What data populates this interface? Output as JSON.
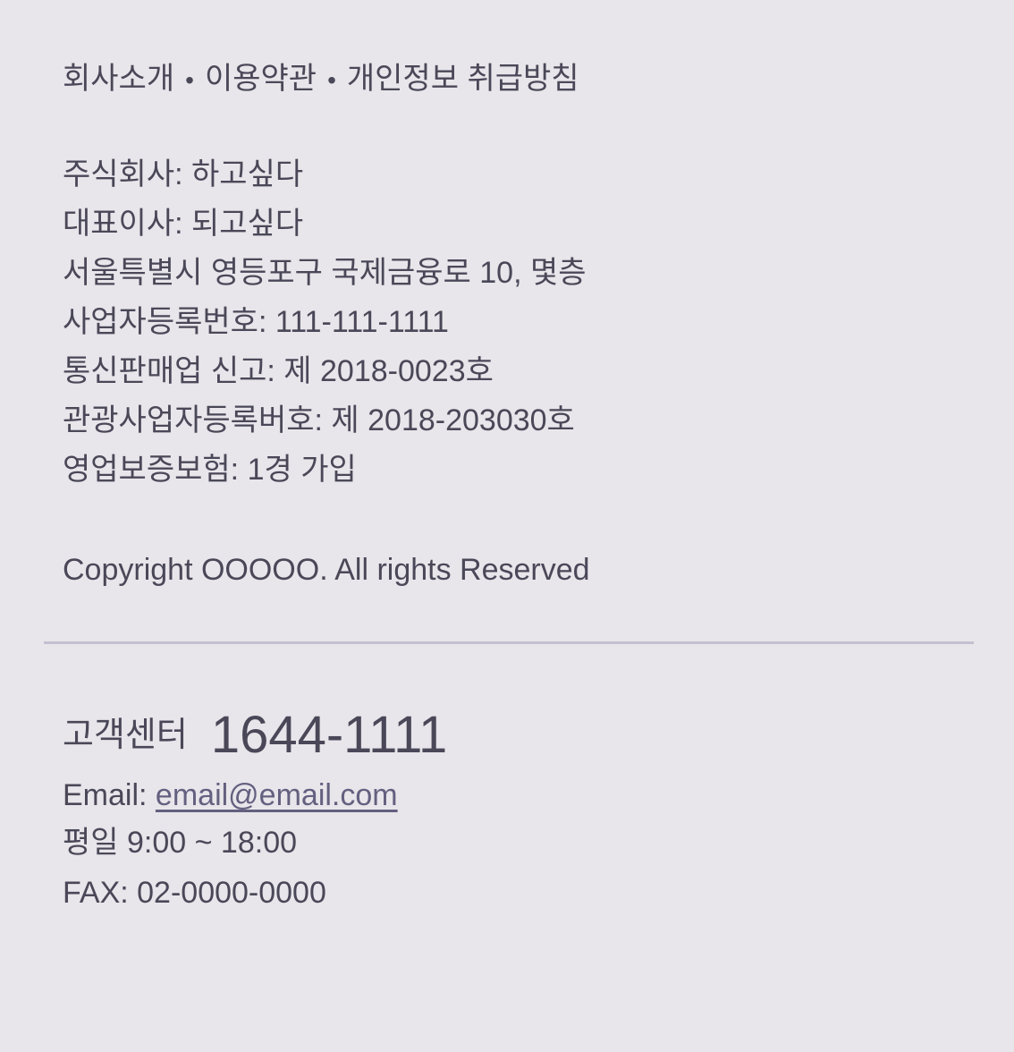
{
  "links": [
    "회사소개",
    "이용약관",
    "개인정보 취급방침"
  ],
  "link_separator": "•",
  "company_info": [
    "주식회사: 하고싶다",
    "대표이사: 되고싶다",
    "서울특별시 영등포구 국제금융로 10, 몇층",
    "사업자등록번호: 111-111-1111",
    "통신판매업 신고: 제 2018-0023호",
    "관광사업자등록버호: 제 2018-203030호",
    "영업보증보험: 1경 가입"
  ],
  "copyright": "Copyright OOOOO. All rights Reserved",
  "customer_center": {
    "label": "고객센터",
    "phone": "1644-1111",
    "email_label": "Email:",
    "email": "email@email.com",
    "hours": "평일 9:00 ~ 18:00",
    "fax": "FAX: 02-0000-0000"
  }
}
